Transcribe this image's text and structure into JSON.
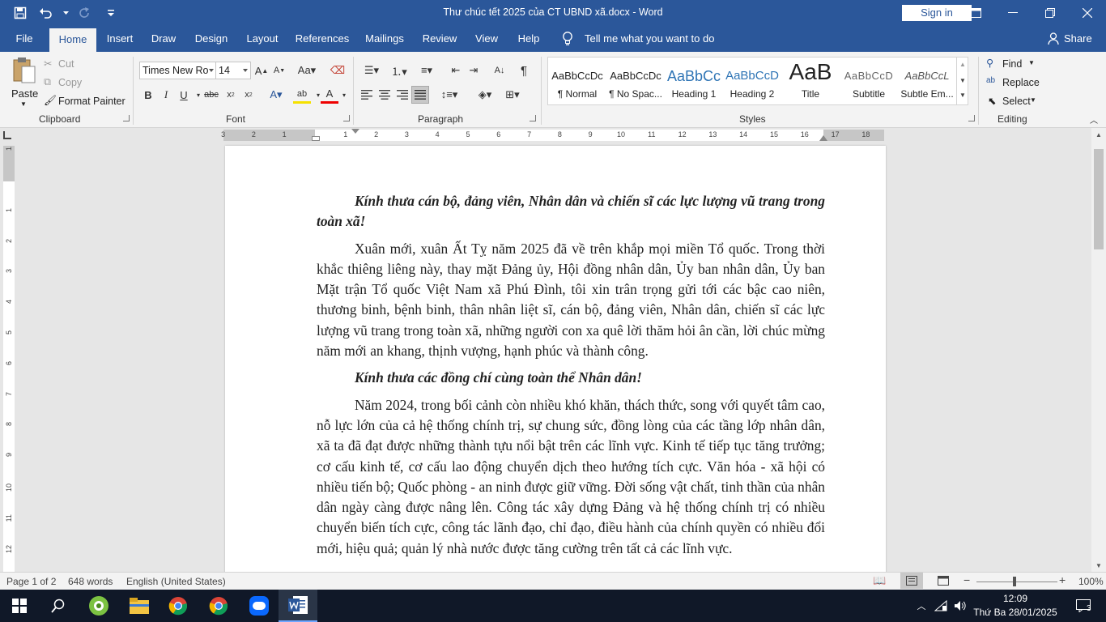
{
  "app": {
    "title": "Thư chúc tết 2025 của CT UBND xã.docx  -  Word",
    "sign_in": "Sign in",
    "accent_color": "#2b579a"
  },
  "tabs": [
    {
      "label": "File"
    },
    {
      "label": "Home",
      "active": true
    },
    {
      "label": "Insert"
    },
    {
      "label": "Draw"
    },
    {
      "label": "Design"
    },
    {
      "label": "Layout"
    },
    {
      "label": "References"
    },
    {
      "label": "Mailings"
    },
    {
      "label": "Review"
    },
    {
      "label": "View"
    },
    {
      "label": "Help"
    }
  ],
  "tell_me": "Tell me what you want to do",
  "share": "Share",
  "clipboard": {
    "paste": "Paste",
    "cut": "Cut",
    "copy": "Copy",
    "format_painter": "Format Painter",
    "label": "Clipboard"
  },
  "font": {
    "name": "Times New Ro",
    "size": "14",
    "label": "Font"
  },
  "paragraph": {
    "label": "Paragraph"
  },
  "styles": {
    "label": "Styles",
    "items": [
      {
        "sample": "AaBbCcDc",
        "name": "¶ Normal"
      },
      {
        "sample": "AaBbCcDc",
        "name": "¶ No Spac..."
      },
      {
        "sample": "AaBbCc",
        "name": "Heading 1"
      },
      {
        "sample": "AaBbCcD",
        "name": "Heading 2"
      },
      {
        "sample": "AaB",
        "name": "Title"
      },
      {
        "sample": "AaBbCcD",
        "name": "Subtitle"
      },
      {
        "sample": "AaBbCcL",
        "name": "Subtle Em..."
      }
    ]
  },
  "editing": {
    "find": "Find",
    "replace": "Replace",
    "select": "Select",
    "label": "Editing"
  },
  "document": {
    "paragraphs": [
      {
        "type": "greet",
        "text": "Kính thưa cán bộ, đảng viên, Nhân dân và chiến sĩ các lực lượng vũ trang trong toàn xã!"
      },
      {
        "type": "normal",
        "text": "Xuân mới, xuân Ất Tỵ năm 2025 đã về trên khắp mọi miền Tổ quốc. Trong thời khắc thiêng liêng này, thay mặt Đảng ủy, Hội đồng nhân dân, Ủy ban nhân dân, Ủy ban Mặt trận Tổ quốc Việt Nam xã Phú Đình, tôi xin trân trọng gửi tới các bậc cao niên, thương binh, bệnh binh, thân nhân liệt sĩ, cán bộ, đảng viên, Nhân dân, chiến sĩ các lực lượng vũ trang trong toàn xã, những người con xa quê lời thăm hỏi ân cần, lời chúc mừng năm mới an khang, thịnh vượng, hạnh phúc và thành công."
      },
      {
        "type": "greet",
        "text": "Kính thưa các đồng chí cùng toàn thể Nhân dân!"
      },
      {
        "type": "normal",
        "text": "Năm 2024, trong bối cảnh còn nhiều khó khăn, thách thức, song với quyết tâm cao, nỗ lực lớn của cả hệ thống chính trị, sự chung sức, đồng lòng của các tầng lớp nhân dân, xã ta đã đạt được những thành tựu nổi bật trên các lĩnh vực. Kinh tế tiếp tục tăng trưởng; cơ cấu kinh tế, cơ cấu lao động chuyển dịch theo hướng tích cực.  Văn hóa - xã hội có nhiều tiến bộ; Quốc phòng - an ninh được giữ vững. Đời sống vật chất, tinh thần của nhân dân ngày càng được nâng lên. Công tác xây dựng Đảng và hệ thống chính trị có nhiều chuyển biến tích cực, công tác lãnh đạo, chỉ đạo, điều hành của chính quyền  có nhiều đổi mới, hiệu quả; quản lý nhà nước được tăng cường trên tất cả các lĩnh vực."
      }
    ]
  },
  "ruler": {
    "h_labels": [
      "3",
      "2",
      "1",
      "1",
      "2",
      "3",
      "4",
      "5",
      "6",
      "7",
      "8",
      "9",
      "10",
      "11",
      "12",
      "13",
      "14",
      "15",
      "16",
      "17",
      "18"
    ],
    "v_labels": [
      "1",
      "1",
      "2",
      "3",
      "4",
      "5",
      "6",
      "7",
      "8",
      "9",
      "10",
      "11",
      "12"
    ]
  },
  "status": {
    "page": "Page 1 of 2",
    "words": "648 words",
    "language": "English (United States)",
    "zoom": "100%"
  },
  "taskbar": {
    "time": "12:09",
    "date": "Thứ Ba 28/01/2025",
    "notifications": "3"
  }
}
